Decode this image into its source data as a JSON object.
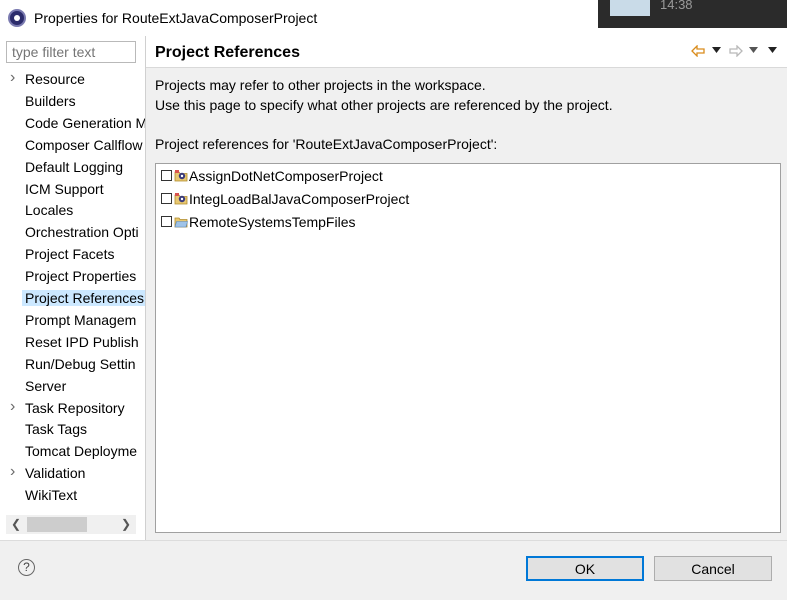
{
  "window": {
    "title": "Properties for RouteExtJavaComposerProject",
    "overlay_time": "14:38"
  },
  "sidebar": {
    "filter_placeholder": "type filter text",
    "items": [
      {
        "label": "Resource",
        "expandable": true
      },
      {
        "label": "Builders",
        "expandable": false
      },
      {
        "label": "Code Generation M",
        "expandable": false
      },
      {
        "label": "Composer Callflow",
        "expandable": false
      },
      {
        "label": "Default Logging",
        "expandable": false
      },
      {
        "label": "ICM Support",
        "expandable": false
      },
      {
        "label": "Locales",
        "expandable": false
      },
      {
        "label": "Orchestration Opti",
        "expandable": false
      },
      {
        "label": "Project Facets",
        "expandable": false
      },
      {
        "label": "Project Properties",
        "expandable": false
      },
      {
        "label": "Project References",
        "expandable": false,
        "selected": true
      },
      {
        "label": "Prompt Managem",
        "expandable": false
      },
      {
        "label": "Reset IPD Publish",
        "expandable": false
      },
      {
        "label": "Run/Debug Settin",
        "expandable": false
      },
      {
        "label": "Server",
        "expandable": false
      },
      {
        "label": "Task Repository",
        "expandable": true
      },
      {
        "label": "Task Tags",
        "expandable": false
      },
      {
        "label": "Tomcat Deployme",
        "expandable": false
      },
      {
        "label": "Validation",
        "expandable": true
      },
      {
        "label": "WikiText",
        "expandable": false
      }
    ]
  },
  "page": {
    "title": "Project References",
    "desc_line1": "Projects may refer to other projects in the workspace.",
    "desc_line2": "Use this page to specify what other projects are referenced by the project.",
    "refs_label": "Project references for 'RouteExtJavaComposerProject':",
    "refs": [
      {
        "name": "AssignDotNetComposerProject",
        "checked": false,
        "icon": "composer-project-icon"
      },
      {
        "name": "IntegLoadBalJavaComposerProject",
        "checked": false,
        "icon": "composer-project-icon"
      },
      {
        "name": "RemoteSystemsTempFiles",
        "checked": false,
        "icon": "folder-icon"
      }
    ]
  },
  "buttons": {
    "ok": "OK",
    "cancel": "Cancel",
    "help": "?"
  },
  "colors": {
    "selection": "#cce8ff",
    "ok_border": "#0078d7",
    "nav_arrow": "#d98c1c"
  }
}
